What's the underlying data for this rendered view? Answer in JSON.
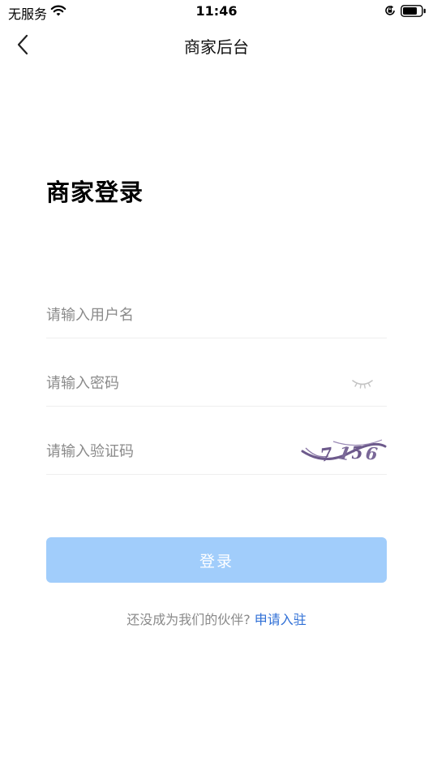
{
  "status_bar": {
    "carrier": "无服务",
    "time": "11:46"
  },
  "nav": {
    "title": "商家后台"
  },
  "heading": "商家登录",
  "form": {
    "username_placeholder": "请输入用户名",
    "password_placeholder": "请输入密码",
    "captcha_placeholder": "请输入验证码",
    "captcha_code": "7156",
    "login_label": "登录"
  },
  "footer": {
    "prompt": "还没成为我们的伙伴?",
    "link": "申请入驻"
  },
  "colors": {
    "login_button_bg": "#a1cdfb",
    "link": "#2f6fd6",
    "placeholder": "#8a8a8a",
    "captcha_ink": "#6d5a8c"
  }
}
